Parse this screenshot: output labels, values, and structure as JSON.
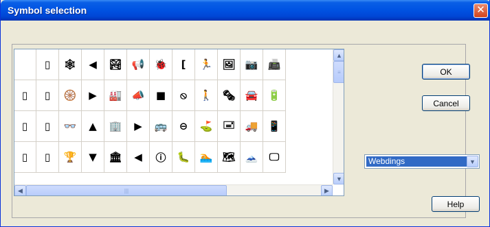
{
  "window": {
    "title": "Symbol selection"
  },
  "buttons": {
    "ok": "OK",
    "cancel": "Cancel",
    "help": "Help"
  },
  "font_select": {
    "value": "Webdings"
  },
  "symbol_grid": {
    "rows": [
      [
        "",
        "▯",
        "🕸",
        "◀",
        "🏞",
        "📢",
        "🐞",
        "[",
        "🏃",
        "🖼",
        "📷",
        "📠"
      ],
      [
        "▯",
        "▯",
        "🛞",
        "▶",
        "🏭",
        "📣",
        "■",
        "⦸",
        "🚶",
        "🗞",
        "🚘",
        "🔋"
      ],
      [
        "▯",
        "▯",
        "👓",
        "▲",
        "🏢",
        "▶",
        "🚌",
        "⊖",
        "⛳",
        "🖃",
        "🚚",
        "📱"
      ],
      [
        "▯",
        "▯",
        "🏆",
        "▼",
        "🏛",
        "◀",
        "ⓘ",
        "🐛",
        "🏊",
        "🗺",
        "🗻",
        "🖵"
      ]
    ]
  },
  "icons": {
    "close": "close-icon",
    "up": "scroll-up-arrow-icon",
    "down": "scroll-down-arrow-icon",
    "left": "scroll-left-arrow-icon",
    "right": "scroll-right-arrow-icon",
    "combo": "chevron-down-icon"
  }
}
